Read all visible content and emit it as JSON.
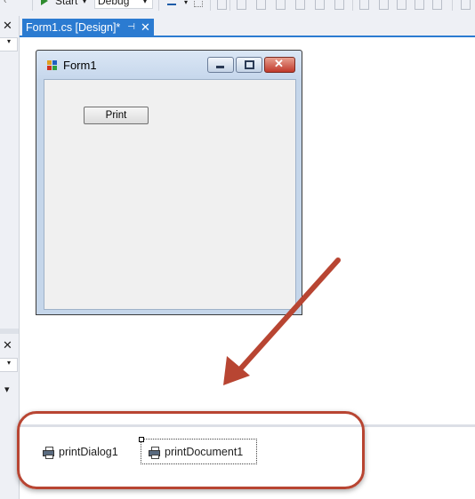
{
  "toolbar": {
    "start_label": "Start",
    "config_value": "Debug"
  },
  "tab": {
    "title": "Form1.cs [Design]*",
    "pin_glyph": "⊣",
    "close_glyph": "✕"
  },
  "left_panel": {
    "close_glyph": "✕",
    "dropdown_glyph": "▾"
  },
  "form": {
    "title": "Form1",
    "print_button_label": "Print"
  },
  "tray": {
    "items": [
      {
        "label": "printDialog1"
      },
      {
        "label": "printDocument1"
      }
    ]
  },
  "colors": {
    "tab_active": "#2b7bd1",
    "annotation_red": "#b84532",
    "form_border": "#c5d6ea",
    "form_client": "#f0f0f0"
  }
}
